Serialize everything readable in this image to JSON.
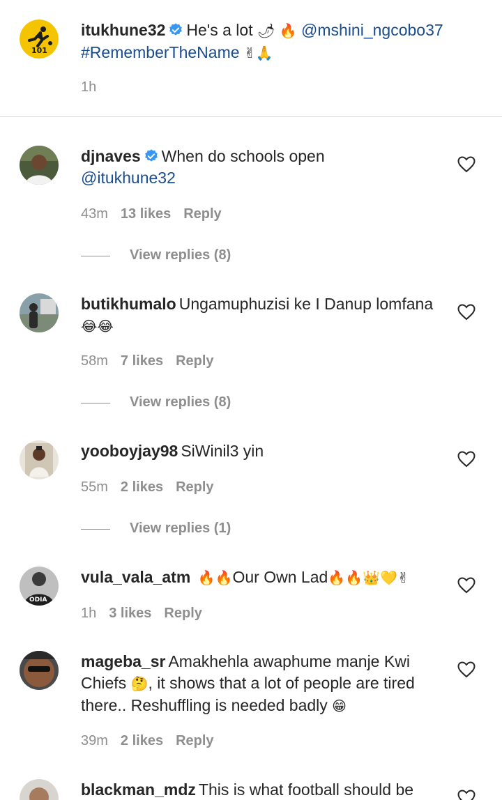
{
  "caption": {
    "username": "itukhune32",
    "text": "He's a lot",
    "emojis1": "🌶 🔥",
    "mention": "@mshini_ngcobo37",
    "hashtag": "#RememberTheName",
    "emojis2": "✌🙏",
    "time": "1h",
    "avatar_text": "101"
  },
  "comments": [
    {
      "username": "djnaves",
      "text": "When do schools open",
      "mention": "@itukhune32",
      "time": "43m",
      "likes": "13 likes",
      "reply": "Reply",
      "view_replies": "View replies (8)"
    },
    {
      "username": "butikhumalo",
      "text": "Ungamuphuzisi ke I Danup lomfana",
      "emojis": "😂😂",
      "time": "58m",
      "likes": "7 likes",
      "reply": "Reply",
      "view_replies": "View replies (8)"
    },
    {
      "username": "yooboyjay98",
      "text": "SiWinil3 yin",
      "time": "55m",
      "likes": "2 likes",
      "reply": "Reply",
      "view_replies": "View replies (1)"
    },
    {
      "username": "vula_vala_atm",
      "emojis_pre": "🔥🔥",
      "text": "Our Own Lad",
      "emojis": "🔥🔥👑💛✌",
      "time": "1h",
      "likes": "3 likes",
      "reply": "Reply"
    },
    {
      "username": "mageba_sr",
      "text": "Amakhehla awaphume manje Kwi Chiefs",
      "emoji_mid": "🤔",
      "text2": ", it shows that a lot of people are tired there.. Reshuffling is needed badly",
      "emojis": "😁",
      "time": "39m",
      "likes": "2 likes",
      "reply": "Reply"
    },
    {
      "username": "blackman_mdz",
      "text": "This is what football should be"
    }
  ],
  "colors": {
    "mention": "#1a4d8f",
    "verified": "#3897f0",
    "muted": "#8e8e8e",
    "text": "#262626"
  }
}
